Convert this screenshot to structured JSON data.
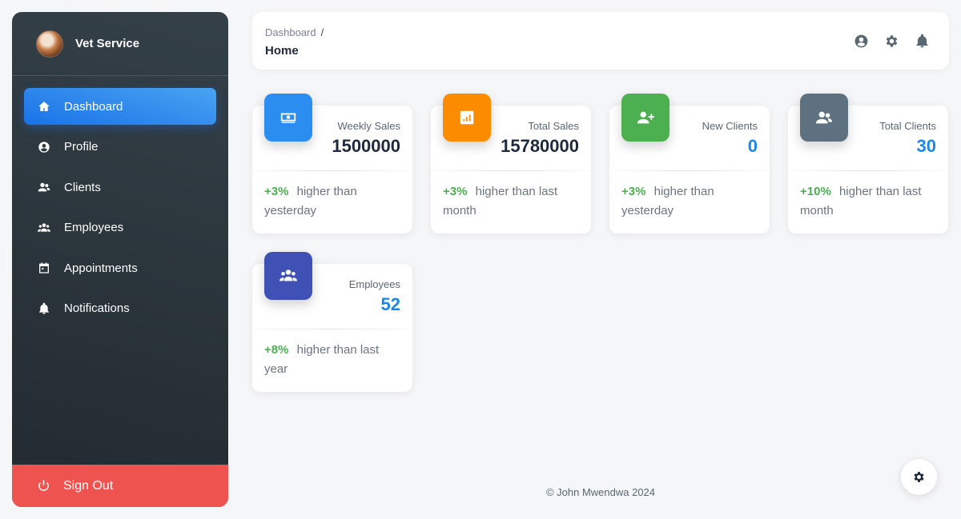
{
  "sidebar": {
    "brand": "Vet Service",
    "items": [
      {
        "label": "Dashboard",
        "icon": "home-icon",
        "active": true
      },
      {
        "label": "Profile",
        "icon": "user-circle-icon"
      },
      {
        "label": "Clients",
        "icon": "users-icon"
      },
      {
        "label": "Employees",
        "icon": "group-icon"
      },
      {
        "label": "Appointments",
        "icon": "calendar-icon"
      },
      {
        "label": "Notifications",
        "icon": "bell-icon"
      }
    ],
    "signout": "Sign Out"
  },
  "topbar": {
    "breadcrumb": "Dashboard",
    "breadcrumb_sep": "/",
    "title": "Home",
    "icons": [
      "account-icon",
      "settings-icon",
      "notifications-icon"
    ]
  },
  "cards": [
    {
      "label": "Weekly Sales",
      "value": "1500000",
      "value_color": "#1e2a3b",
      "pct": "+3%",
      "text": "higher than yesterday",
      "icon": "money-icon",
      "color": "#2b8df0"
    },
    {
      "label": "Total Sales",
      "value": "15780000",
      "value_color": "#1e2a3b",
      "pct": "+3%",
      "text": "higher than last month",
      "icon": "chart-icon",
      "color": "#fb8c00"
    },
    {
      "label": "New Clients",
      "value": "0",
      "value_color": "#1a88e8",
      "pct": "+3%",
      "text": "higher than yesterday",
      "icon": "add-user-icon",
      "color": "#4caf50"
    },
    {
      "label": "Total Clients",
      "value": "30",
      "value_color": "#1a88e8",
      "pct": "+10%",
      "text": "higher than last month",
      "icon": "users-icon",
      "color": "#5d7180"
    },
    {
      "label": "Employees",
      "value": "52",
      "value_color": "#1a88e8",
      "pct": "+8%",
      "text": "higher than last year",
      "icon": "group-icon",
      "color": "#3f51b5"
    }
  ],
  "footer": "© John Mwendwa 2024",
  "colors": {
    "accent": "#1a73e8",
    "signout": "#ef5350",
    "positive": "#4caf50"
  }
}
